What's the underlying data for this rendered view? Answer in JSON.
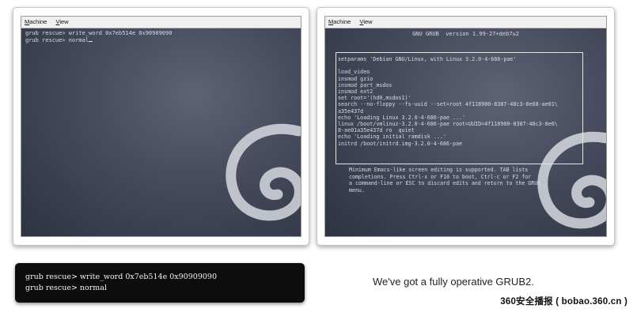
{
  "left_vm": {
    "menu": [
      {
        "underline": "M",
        "rest": "achine"
      },
      {
        "underline": "V",
        "rest": "iew"
      }
    ],
    "console_lines": [
      "grub rescue> write_word 0x7eb514e 0x90909090",
      "grub rescue> normal"
    ]
  },
  "right_vm": {
    "menu": [
      {
        "underline": "M",
        "rest": "achine"
      },
      {
        "underline": "V",
        "rest": "iew"
      }
    ],
    "header": "GNU GRUB  version 1.99-27+deb7u2",
    "editor_lines": [
      "setparams 'Debian GNU/Linux, with Linux 3.2.0-4-686-pae'",
      "",
      "load_video",
      "insmod gzio",
      "insmod part_msdos",
      "insmod ext2",
      "set root='(hd0,msdos1)'",
      "search --no-floppy --fs-uuid --set=root 4f118900-8387-48c3-8e68-ae01\\",
      "a35e437d",
      "echo 'Loading Linux 3.2.0-4-686-pae ...'",
      "linux /boot/vmlinuz-3.2.0-4-686-pae root=UUID=4f118900-8387-48c3-8e6\\",
      "8-ae01a35e437d ro  quiet",
      "echo 'Loading initial ramdisk ...'",
      "initrd /boot/initrd.img-3.2.0-4-686-pae"
    ],
    "help_lines": [
      "Minimum Emacs-like screen editing is supported. TAB lists",
      "completions. Press Ctrl-x or F10 to boot, Ctrl-c or F2 for",
      "a command-line or ESC to discard edits and return to the GRUB",
      "menu."
    ]
  },
  "terminal": {
    "lines": [
      "grub rescue> write_word 0x7eb514e 0x90909090",
      "grub rescue> normal"
    ]
  },
  "caption": "We've got a fully operative GRUB2.",
  "watermark": "360安全播报 ( bobao.360.cn )"
}
